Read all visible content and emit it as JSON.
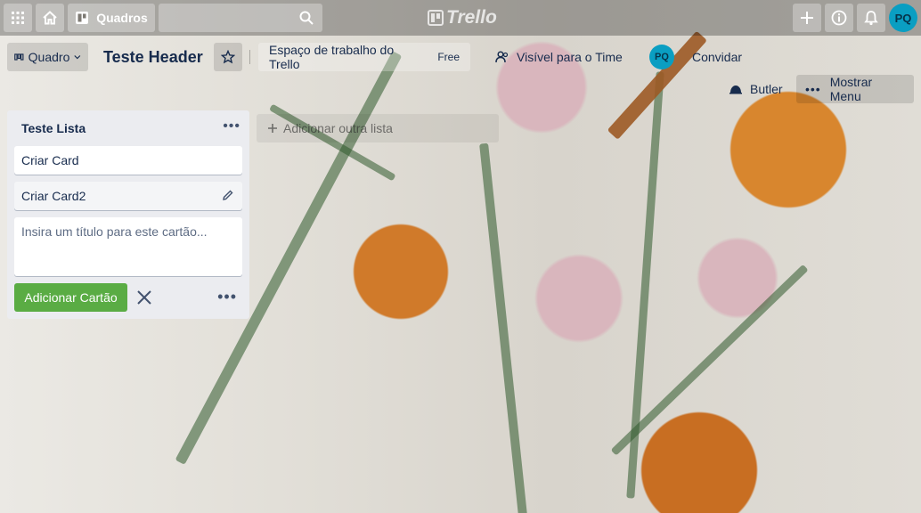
{
  "topbar": {
    "apps_icon": "grid-icon",
    "home_icon": "home-icon",
    "boards_label": "Quadros",
    "search_placeholder": "",
    "logo_text": "Trello",
    "create_icon": "plus-icon",
    "info_icon": "info-icon",
    "notifications_icon": "bell-icon",
    "user_initials": "PQ"
  },
  "board_header": {
    "view_label": "Quadro",
    "title": "Teste Header",
    "star_icon": "star-icon",
    "workspace_label": "Espaço de trabalho do Trello",
    "workspace_badge": "Free",
    "visibility_label": "Visível para o Time",
    "member_initials": "PQ",
    "invite_label": "Convidar",
    "butler_label": "Butler",
    "menu_label": "Mostrar Menu"
  },
  "list": {
    "title": "Teste Lista",
    "cards": [
      {
        "title": "Criar Card"
      },
      {
        "title": "Criar Card2"
      }
    ],
    "composer_placeholder": "Insira um título para este cartão...",
    "add_card_label": "Adicionar Cartão"
  },
  "add_list_label": "Adicionar outra lista",
  "colors": {
    "add_button": "#5aac44",
    "avatar": "#0a9ec2",
    "list_bg": "#ebecf0"
  }
}
